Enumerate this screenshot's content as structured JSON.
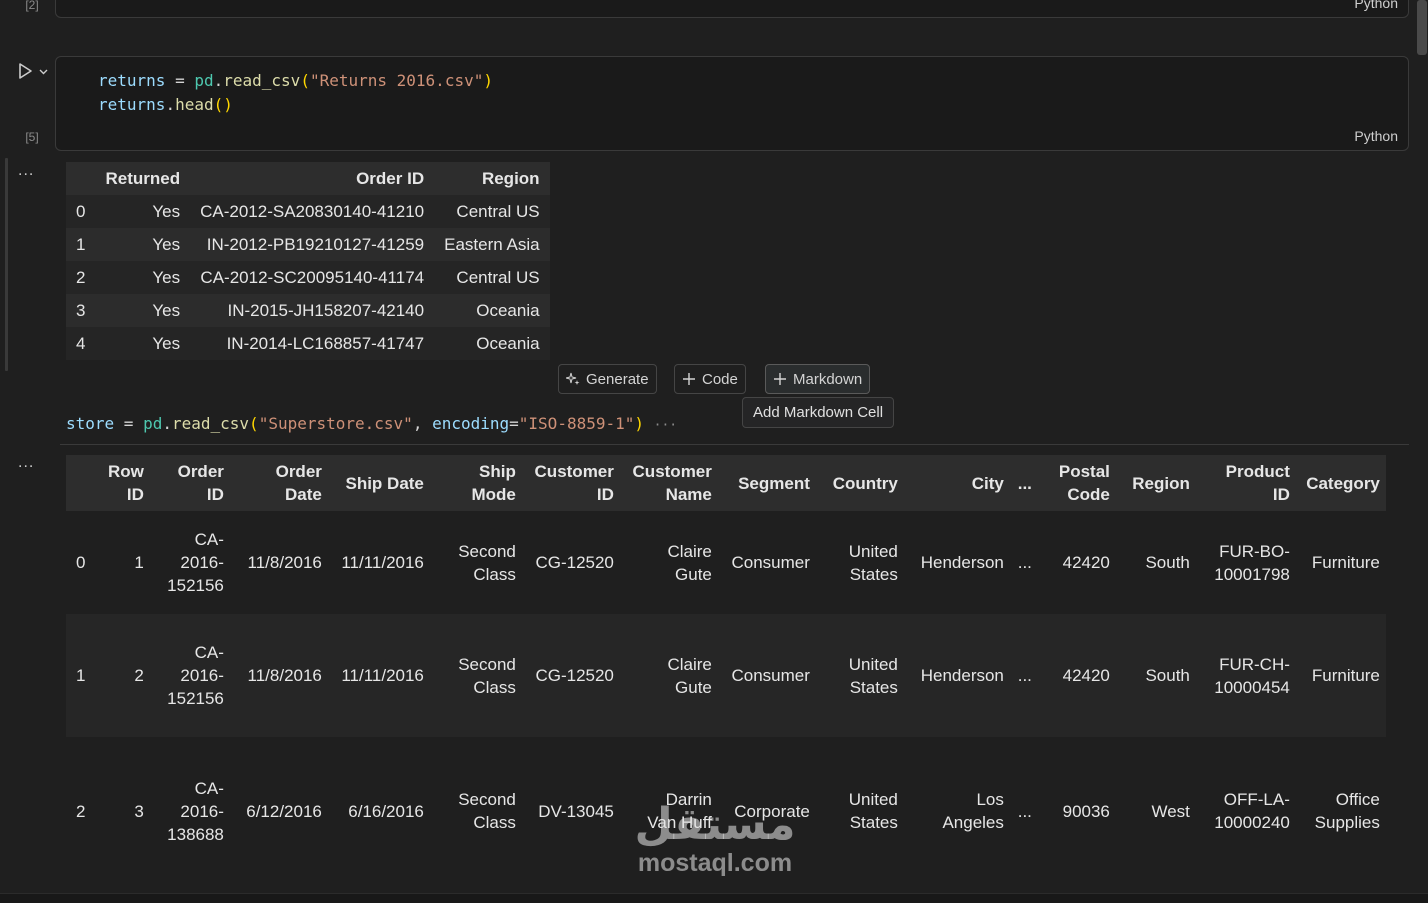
{
  "prev_cell": {
    "exec_count": "[2]",
    "language": "Python"
  },
  "cell5": {
    "exec_count": "[5]",
    "language": "Python",
    "code": {
      "line1": {
        "var": "returns",
        "eq": " = ",
        "mod": "pd",
        "dot": ".",
        "fn": "read_csv",
        "open": "(",
        "str": "\"Returns 2016.csv\"",
        "close": ")"
      },
      "line2": {
        "var": "returns",
        "dot": ".",
        "fn": "head",
        "parens": "()"
      }
    },
    "output_more": "...",
    "table": {
      "columns": [
        "",
        "Returned",
        "Order ID",
        "Region"
      ],
      "rows": [
        [
          "0",
          "Yes",
          "CA-2012-SA20830140-41210",
          "Central US"
        ],
        [
          "1",
          "Yes",
          "IN-2012-PB19210127-41259",
          "Eastern Asia"
        ],
        [
          "2",
          "Yes",
          "CA-2012-SC20095140-41174",
          "Central US"
        ],
        [
          "3",
          "Yes",
          "IN-2015-JH158207-42140",
          "Oceania"
        ],
        [
          "4",
          "Yes",
          "IN-2014-LC168857-41747",
          "Oceania"
        ]
      ]
    }
  },
  "toolbar": {
    "generate_label": "Generate",
    "code_label": "Code",
    "markdown_label": "Markdown",
    "tooltip": "Add Markdown Cell"
  },
  "cell6": {
    "code": {
      "var": "store",
      "eq": " = ",
      "mod": "pd",
      "dot": ".",
      "fn": "read_csv",
      "open": "(",
      "str1": "\"Superstore.csv\"",
      "comma": ", ",
      "kw": "encoding",
      "kweq": "=",
      "str2": "\"ISO-8859-1\"",
      "close": ")",
      "ellipsis": "···"
    },
    "output_more": "...",
    "table": {
      "columns": [
        [
          "",
          ""
        ],
        [
          "Row",
          "ID"
        ],
        [
          "Order",
          "ID"
        ],
        [
          "Order",
          "Date"
        ],
        [
          "Ship Date",
          ""
        ],
        [
          "Ship",
          "Mode"
        ],
        [
          "Customer",
          "ID"
        ],
        [
          "Customer",
          "Name"
        ],
        [
          "Segment",
          ""
        ],
        [
          "Country",
          ""
        ],
        [
          "City",
          ""
        ],
        [
          "...",
          ""
        ],
        [
          "Postal",
          "Code"
        ],
        [
          "Region",
          ""
        ],
        [
          "Product",
          "ID"
        ],
        [
          "Category",
          ""
        ]
      ],
      "rows": [
        [
          [
            "0"
          ],
          [
            "1"
          ],
          [
            "CA-",
            "2016-",
            "152156"
          ],
          [
            "11/8/2016"
          ],
          [
            "11/11/2016"
          ],
          [
            "Second",
            "Class"
          ],
          [
            "CG-12520"
          ],
          [
            "Claire",
            "Gute"
          ],
          [
            "Consumer"
          ],
          [
            "United",
            "States"
          ],
          [
            "Henderson"
          ],
          [
            "..."
          ],
          [
            "42420"
          ],
          [
            "South"
          ],
          [
            "FUR-BO-",
            "10001798"
          ],
          [
            "Furniture"
          ]
        ],
        [
          [
            "1"
          ],
          [
            "2"
          ],
          [
            "CA-",
            "2016-",
            "152156"
          ],
          [
            "11/8/2016"
          ],
          [
            "11/11/2016"
          ],
          [
            "Second",
            "Class"
          ],
          [
            "CG-12520"
          ],
          [
            "Claire",
            "Gute"
          ],
          [
            "Consumer"
          ],
          [
            "United",
            "States"
          ],
          [
            "Henderson"
          ],
          [
            "..."
          ],
          [
            "42420"
          ],
          [
            "South"
          ],
          [
            "FUR-CH-",
            "10000454"
          ],
          [
            "Furniture"
          ]
        ],
        [
          [
            "2"
          ],
          [
            "3"
          ],
          [
            "CA-",
            "2016-",
            "138688"
          ],
          [
            "6/12/2016"
          ],
          [
            "6/16/2016"
          ],
          [
            "Second",
            "Class"
          ],
          [
            "DV-13045"
          ],
          [
            "Darrin",
            "Van Huff"
          ],
          [
            "Corporate"
          ],
          [
            "United",
            "States"
          ],
          [
            "Los",
            "Angeles"
          ],
          [
            "..."
          ],
          [
            "90036"
          ],
          [
            "West"
          ],
          [
            "OFF-LA-",
            "10000240"
          ],
          [
            "Office",
            "Supplies"
          ]
        ]
      ]
    }
  },
  "watermark": {
    "arabic": "مستقل",
    "latin": "mostaql.com"
  },
  "icons": {
    "run": "play-icon",
    "chevron": "chevron-down-icon",
    "generate": "sparkle-icon",
    "add": "plus-icon"
  }
}
